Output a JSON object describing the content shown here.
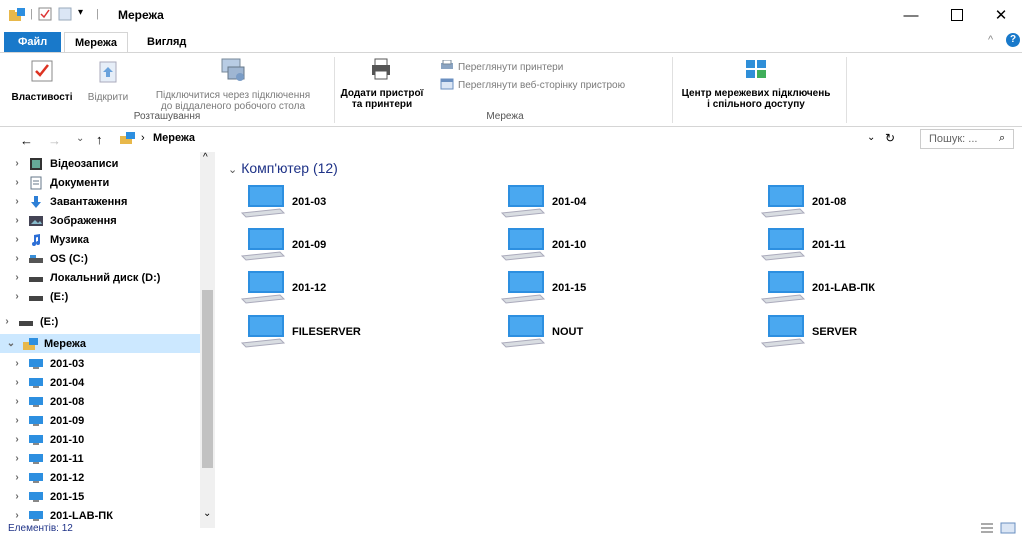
{
  "window": {
    "title": "Мережа"
  },
  "ribbon_tabs": {
    "file": "Файл",
    "network": "Мережа",
    "view": "Вигляд"
  },
  "ribbon": {
    "properties": "Властивості",
    "open": "Відкрити",
    "remote_desktop_line1": "Підключитися через підключення",
    "remote_desktop_line2": "до віддаленого робочого стола",
    "group_location": "Розташування",
    "add_devices_line1": "Додати пристрої",
    "add_devices_line2": "та принтери",
    "view_printers": "Переглянути принтери",
    "view_device_webpage": "Переглянути веб-сторінку пристрою",
    "group_network": "Мережа",
    "network_center_line1": "Центр мережевих підключень",
    "network_center_line2": "і спільного доступу"
  },
  "address": {
    "path": "Мережа",
    "search_placeholder": "Пошук: ..."
  },
  "nav": {
    "items": [
      {
        "label": "Відеозаписи",
        "icon": "video-folder-icon"
      },
      {
        "label": "Документи",
        "icon": "documents-folder-icon"
      },
      {
        "label": "Завантаження",
        "icon": "downloads-folder-icon"
      },
      {
        "label": "Зображення",
        "icon": "pictures-folder-icon"
      },
      {
        "label": "Музика",
        "icon": "music-folder-icon"
      },
      {
        "label": "OS (C:)",
        "icon": "drive-icon"
      },
      {
        "label": "Локальний диск (D:)",
        "icon": "drive-icon"
      },
      {
        "label": "(E:)",
        "icon": "drive-icon"
      },
      {
        "label": "(E:)",
        "icon": "drive-icon"
      },
      {
        "label": "Мережа",
        "icon": "network-icon"
      },
      {
        "label": "201-03",
        "icon": "computer-icon"
      },
      {
        "label": "201-04",
        "icon": "computer-icon"
      },
      {
        "label": "201-08",
        "icon": "computer-icon"
      },
      {
        "label": "201-09",
        "icon": "computer-icon"
      },
      {
        "label": "201-10",
        "icon": "computer-icon"
      },
      {
        "label": "201-11",
        "icon": "computer-icon"
      },
      {
        "label": "201-12",
        "icon": "computer-icon"
      },
      {
        "label": "201-15",
        "icon": "computer-icon"
      },
      {
        "label": "201-LAB-ПК",
        "icon": "computer-icon"
      }
    ]
  },
  "content": {
    "group_header": "Комп'ютер (12)",
    "computers": [
      "201-03",
      "201-04",
      "201-08",
      "201-09",
      "201-10",
      "201-11",
      "201-12",
      "201-15",
      "201-LAB-ПК",
      "FILESERVER",
      "NOUT",
      "SERVER"
    ]
  },
  "status": {
    "items_count": "Елементів: 12"
  },
  "colors": {
    "accent": "#1979ca",
    "selected": "#cce8ff",
    "header": "#1e3287"
  }
}
